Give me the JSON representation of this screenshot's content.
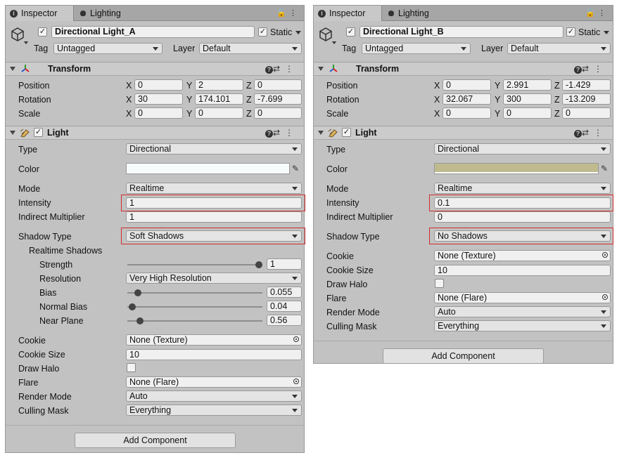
{
  "tabs": {
    "inspector": "Inspector",
    "lighting": "Lighting"
  },
  "common": {
    "static_label": "Static",
    "tag_label": "Tag",
    "tag_value": "Untagged",
    "layer_label": "Layer",
    "layer_value": "Default",
    "transform_title": "Transform",
    "position": "Position",
    "rotation": "Rotation",
    "scale": "Scale",
    "x": "X",
    "y": "Y",
    "z": "Z",
    "light_title": "Light",
    "type_label": "Type",
    "color_label": "Color",
    "mode_label": "Mode",
    "intensity_label": "Intensity",
    "indirect_label": "Indirect Multiplier",
    "shadow_type_label": "Shadow Type",
    "realtime_shadows": "Realtime Shadows",
    "strength": "Strength",
    "resolution": "Resolution",
    "bias": "Bias",
    "normal_bias": "Normal Bias",
    "near_plane": "Near Plane",
    "cookie_label": "Cookie",
    "cookie_size_label": "Cookie Size",
    "draw_halo_label": "Draw Halo",
    "flare_label": "Flare",
    "render_mode_label": "Render Mode",
    "culling_mask_label": "Culling Mask",
    "add_component": "Add Component"
  },
  "panelA": {
    "name": "Directional Light_A",
    "position": [
      "0",
      "2",
      "0"
    ],
    "rotation": [
      "30",
      "174.101",
      "-7.699"
    ],
    "scale": [
      "0",
      "0",
      "0"
    ],
    "type": "Directional",
    "color": "#f6fbfb",
    "mode": "Realtime",
    "intensity": "1",
    "indirect": "1",
    "shadow_type": "Soft Shadows",
    "strength": "1",
    "strength_level": 1.0,
    "resolution": "Very High Resolution",
    "bias": "0.055",
    "bias_level": 0.055,
    "normal_bias": "0.04",
    "normal_bias_level": 0.013,
    "near_plane": "0.56",
    "near_plane_level": 0.07,
    "cookie": "None (Texture)",
    "cookie_size": "10",
    "flare": "None (Flare)",
    "render_mode": "Auto",
    "culling_mask": "Everything"
  },
  "panelB": {
    "name": "Directional Light_B",
    "position": [
      "0",
      "2.991",
      "-1.429"
    ],
    "rotation": [
      "32.067",
      "300",
      "-13.209"
    ],
    "scale": [
      "0",
      "0",
      "0"
    ],
    "type": "Directional",
    "color": "#bfbb8f",
    "mode": "Realtime",
    "intensity": "0.1",
    "indirect": "0",
    "shadow_type": "No Shadows",
    "cookie": "None (Texture)",
    "cookie_size": "10",
    "flare": "None (Flare)",
    "render_mode": "Auto",
    "culling_mask": "Everything"
  },
  "colors": {
    "highlight": "#d02c2c",
    "panel_bg": "#c2c2c2"
  }
}
